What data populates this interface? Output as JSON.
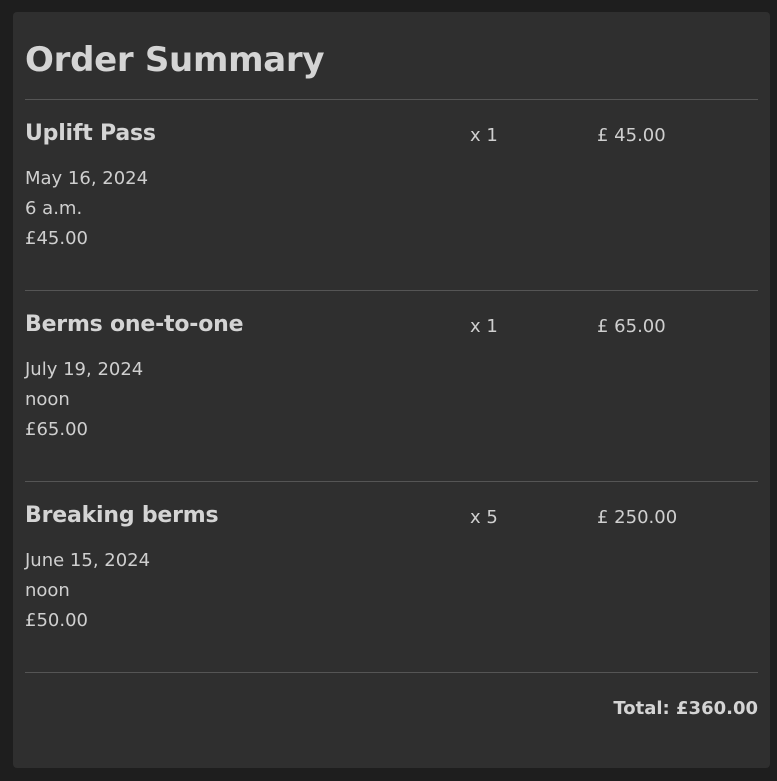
{
  "order": {
    "title": "Order Summary",
    "items": [
      {
        "name": "Uplift Pass",
        "date": "May 16, 2024",
        "time": "6 a.m.",
        "unit_price": "£45.00",
        "quantity": "x 1",
        "line_total": "£ 45.00"
      },
      {
        "name": "Berms one-to-one",
        "date": "July 19, 2024",
        "time": "noon",
        "unit_price": "£65.00",
        "quantity": "x 1",
        "line_total": "£ 65.00"
      },
      {
        "name": "Breaking berms",
        "date": "June 15, 2024",
        "time": "noon",
        "unit_price": "£50.00",
        "quantity": "x 5",
        "line_total": "£ 250.00"
      }
    ],
    "total": "Total: £360.00"
  }
}
